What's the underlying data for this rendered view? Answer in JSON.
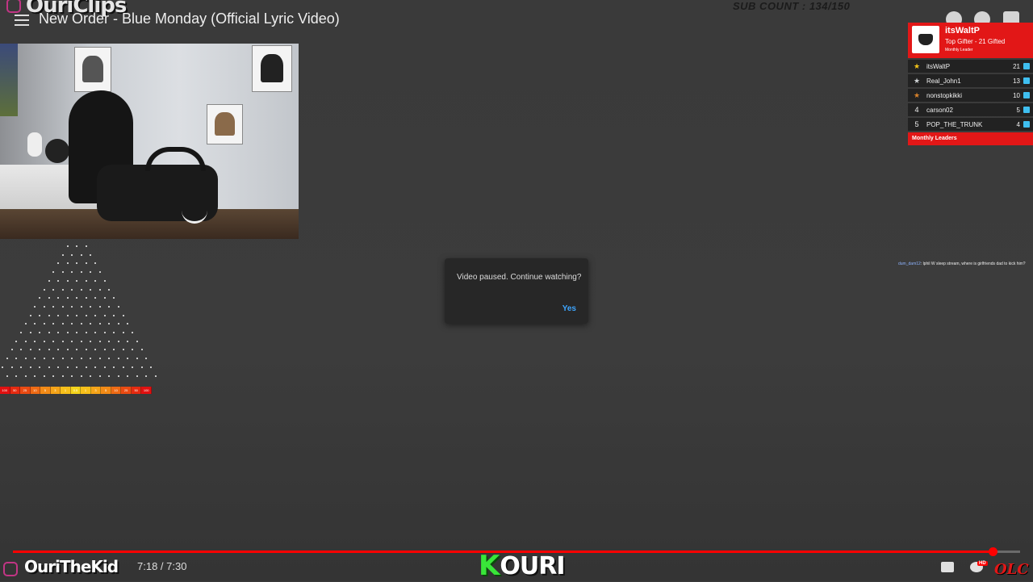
{
  "brand": {
    "name": "OuriClips"
  },
  "video": {
    "title": "New Order - Blue Monday (Official Lyric Video)"
  },
  "overlay": {
    "sub_count": "SUB COUNT : 134/150"
  },
  "dialog": {
    "message": "Video paused. Continue watching?",
    "confirm_label": "Yes"
  },
  "leaderboard": {
    "top": {
      "name": "itsWaltP",
      "subtitle": "Top Gifter - 21 Gifted",
      "tag": "Monthly Leader"
    },
    "rows": [
      {
        "rank": "★",
        "rank_color": "#f5c518",
        "name": "itsWaltP",
        "count": "21"
      },
      {
        "rank": "★",
        "rank_color": "#cfd3d6",
        "name": "Real_John1",
        "count": "13"
      },
      {
        "rank": "★",
        "rank_color": "#d9822b",
        "name": "nonstopkikki",
        "count": "10"
      },
      {
        "rank": "4",
        "rank_color": "#eeeeee",
        "name": "carson02",
        "count": "5"
      },
      {
        "rank": "5",
        "rank_color": "#eeeeee",
        "name": "POP_THE_TRUNK",
        "count": "4"
      }
    ],
    "footer": "Monthly Leaders"
  },
  "chat": {
    "user": "dum_dam12",
    "message": ": lphil W sleep stream, where is girlfriends dad to kick him?"
  },
  "player": {
    "current_time": "7:18",
    "duration": "7:30",
    "time_display": "7:18 / 7:30",
    "progress_fraction": 0.973,
    "channel_name": "OuriTheKid",
    "hd_badge": "HD"
  },
  "logos": {
    "kouri_first": "K",
    "kouri_rest": "OURI",
    "olc": "OLC"
  },
  "plinko": {
    "slots": [
      "100",
      "50",
      "25",
      "10",
      "5",
      "3",
      "1",
      "0.5",
      "1",
      "3",
      "5",
      "10",
      "25",
      "50",
      "100"
    ],
    "slot_colors": [
      "#e01010",
      "#e52a10",
      "#ea4a12",
      "#ee6a14",
      "#f28a16",
      "#f5a418",
      "#f7c01a",
      "#f4d41c",
      "#f7c01a",
      "#f5a418",
      "#f28a16",
      "#ee6a14",
      "#ea4a12",
      "#e52a10",
      "#e01010"
    ]
  },
  "colors": {
    "accent_red": "#ff0000",
    "link_blue": "#3ea6ff",
    "leaderboard_red": "#e21717"
  }
}
